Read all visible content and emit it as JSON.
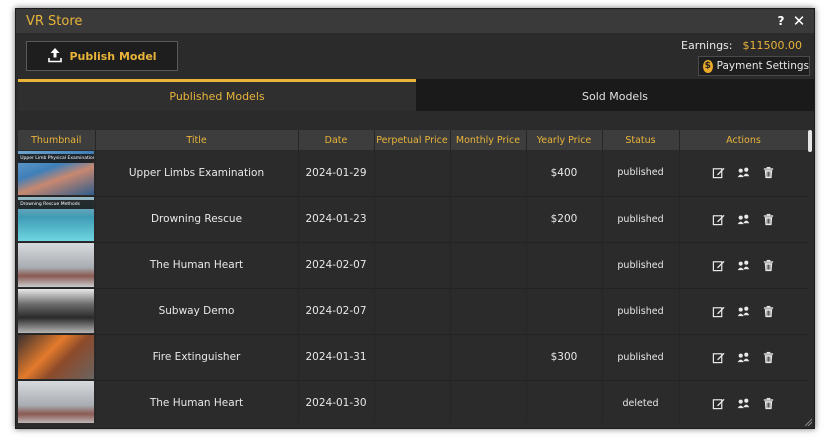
{
  "window": {
    "title": "VR Store",
    "help_label": "?",
    "close_label": "✕"
  },
  "toolbar": {
    "publish_label": "Publish Model"
  },
  "earnings": {
    "label": "Earnings:",
    "amount": "$11500.00"
  },
  "payment": {
    "label": "Payment Settings",
    "icon_symbol": "$"
  },
  "tabs": [
    {
      "label": "Published Models",
      "active": true
    },
    {
      "label": "Sold Models",
      "active": false
    }
  ],
  "table": {
    "headers": [
      "Thumbnail",
      "Title",
      "Date",
      "Perpetual Price",
      "Monthly Price",
      "Yearly Price",
      "Status",
      "Actions"
    ],
    "rows": [
      {
        "thumb_caption": "Upper Limb Physical Examination",
        "thumb_icon": "clinic-scene-thumbnail",
        "title": "Upper Limbs Examination",
        "date": "2024-01-29",
        "perpetual": "",
        "monthly": "",
        "yearly": "$400",
        "status": "published"
      },
      {
        "thumb_caption": "Drowning Rescue Methods",
        "thumb_icon": "pool-scene-thumbnail",
        "title": "Drowning Rescue",
        "date": "2024-01-23",
        "perpetual": "",
        "monthly": "",
        "yearly": "$200",
        "status": "published"
      },
      {
        "thumb_caption": "",
        "thumb_icon": "heart-lab-thumbnail",
        "title": "The Human Heart",
        "date": "2024-02-07",
        "perpetual": "",
        "monthly": "",
        "yearly": "",
        "status": "published"
      },
      {
        "thumb_caption": "",
        "thumb_icon": "subway-interior-thumbnail",
        "title": "Subway Demo",
        "date": "2024-02-07",
        "perpetual": "",
        "monthly": "",
        "yearly": "",
        "status": "published"
      },
      {
        "thumb_caption": "",
        "thumb_icon": "fire-scene-thumbnail",
        "title": "Fire Extinguisher",
        "date": "2024-01-31",
        "perpetual": "",
        "monthly": "",
        "yearly": "$300",
        "status": "published"
      },
      {
        "thumb_caption": "",
        "thumb_icon": "heart-lab-thumbnail",
        "title": "The Human Heart",
        "date": "2024-01-30",
        "perpetual": "",
        "monthly": "",
        "yearly": "",
        "status": "deleted"
      }
    ]
  },
  "colors": {
    "accent": "#e9b43a",
    "background": "#2b2b2b",
    "header": "#3d3d3d",
    "titlebar": "#3a3a3a"
  },
  "icons": {
    "publish": "upload-icon",
    "edit": "edit-icon",
    "share": "people-icon",
    "delete": "trash-icon",
    "coin": "dollar-coin-icon"
  }
}
